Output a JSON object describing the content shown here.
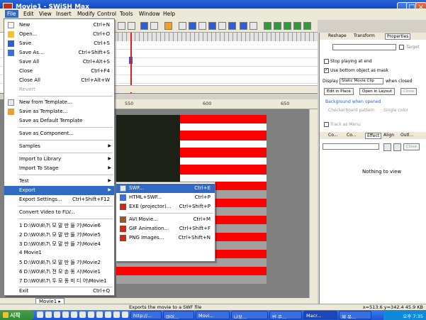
{
  "window": {
    "title": "Movie1 - SWiSH Max"
  },
  "menubar": {
    "items": [
      "File",
      "Edit",
      "View",
      "Insert",
      "Modify",
      "Control",
      "Tools",
      "Window",
      "Help"
    ]
  },
  "file_menu": {
    "items": [
      {
        "label": "New",
        "shortcut": "Ctrl+N",
        "icon": "new-doc-icon"
      },
      {
        "label": "Open...",
        "shortcut": "Ctrl+O",
        "icon": "open-folder-icon"
      },
      {
        "label": "Save",
        "shortcut": "Ctrl+S",
        "icon": "save-icon"
      },
      {
        "label": "Save As...",
        "shortcut": "Ctrl+Shift+S",
        "icon": "save-as-icon"
      },
      {
        "label": "Save All",
        "shortcut": "Ctrl+Alt+S",
        "icon": ""
      },
      {
        "label": "Close",
        "shortcut": "Ctrl+F4",
        "icon": ""
      },
      {
        "label": "Close All",
        "shortcut": "Ctrl+Alt+W",
        "icon": ""
      },
      {
        "label": "Revert",
        "shortcut": "",
        "icon": "",
        "disabled": true
      },
      {
        "label": "New from Template...",
        "shortcut": "",
        "icon": "template-icon"
      },
      {
        "label": "Save as Template...",
        "shortcut": "",
        "icon": "save-template-icon"
      },
      {
        "label": "Save as Default Template",
        "shortcut": "",
        "icon": ""
      },
      {
        "label": "Save as Component...",
        "shortcut": "",
        "icon": ""
      },
      {
        "label": "Samples",
        "shortcut": "",
        "icon": "",
        "submenu": true
      },
      {
        "label": "Import to Library",
        "shortcut": "",
        "icon": "",
        "submenu": true
      },
      {
        "label": "Import To Stage",
        "shortcut": "",
        "icon": "",
        "submenu": true
      },
      {
        "label": "Test",
        "shortcut": "",
        "icon": "",
        "submenu": true
      },
      {
        "label": "Export",
        "shortcut": "",
        "icon": "",
        "submenu": true,
        "highlight": true
      },
      {
        "label": "Export Settings...",
        "shortcut": "Ctrl+Shift+F12",
        "icon": ""
      },
      {
        "label": "Convert Video to FLV...",
        "shortcut": "",
        "icon": ""
      },
      {
        "label": "1 D:\\W0\\8\\7\\ 모 말 만 들 기\\Movie6",
        "shortcut": "",
        "icon": ""
      },
      {
        "label": "2 D:\\W0\\8\\7\\ 모 말 만 들 기\\Movie5",
        "shortcut": "",
        "icon": ""
      },
      {
        "label": "3 D:\\W0\\8\\7\\ 모 말 만 들 기\\Movie4",
        "shortcut": "",
        "icon": ""
      },
      {
        "label": "4 Movie1",
        "shortcut": "",
        "icon": ""
      },
      {
        "label": "5 D:\\W0\\8\\7\\ 모 말 만 들 기\\Movie2",
        "shortcut": "",
        "icon": ""
      },
      {
        "label": "6 D:\\W0\\8\\7\\ 전 모 손 동 시\\Movie1",
        "shortcut": "",
        "icon": ""
      },
      {
        "label": "7 D:\\W0\\8\\7\\ 두 모 동 미 디 어\\Movie1",
        "shortcut": "",
        "icon": ""
      },
      {
        "label": "Exit",
        "shortcut": "Ctrl+Q",
        "icon": ""
      }
    ]
  },
  "export_submenu": {
    "items": [
      {
        "label": "SWF...",
        "shortcut": "Ctrl+E",
        "icon": "swf-icon",
        "highlight": true
      },
      {
        "label": "HTML+SWF...",
        "shortcut": "Ctrl+P",
        "icon": "html-icon"
      },
      {
        "label": "EXE (projector)...",
        "shortcut": "Ctrl+Shift+P",
        "icon": "exe-icon"
      },
      {
        "label": "AVI Movie...",
        "shortcut": "Ctrl+M",
        "icon": "avi-icon"
      },
      {
        "label": "GIF Animation...",
        "shortcut": "Ctrl+Shift+F",
        "icon": "gif-icon"
      },
      {
        "label": "PNG Images...",
        "shortcut": "Ctrl+Shift+N",
        "icon": "png-icon"
      }
    ]
  },
  "stage": {
    "ruler_ticks": [
      "550",
      "600",
      "650"
    ]
  },
  "tabs": {
    "movie_tab": "Movie1 ▸"
  },
  "properties": {
    "tabs": [
      "Reshape",
      "Transform",
      "Properties"
    ],
    "target_label": "Target",
    "stop_playing": "Stop playing at end",
    "bottom_mask": "Use bottom object as mask",
    "display_label": "Display",
    "display_value": "Static Movie Clip",
    "when_closed": "when closed",
    "btn_edit": "Edit in Place",
    "btn_open": "Open in Layout",
    "btn_close": "Close",
    "background_label": "Background when opened",
    "checkerboard": "Checkerboard pattern",
    "single_color": "Single color",
    "track_as_menu": "Track as Menu"
  },
  "lower_panel": {
    "tabs": [
      "Co...",
      "Co...",
      "Effect",
      "Align",
      "Outl..."
    ],
    "empty_text": "Nothing to view"
  },
  "status": {
    "message": "Exports the movie to a SWF file",
    "coords": "x=513.6 y=342.4 45.9 KB"
  },
  "taskbar": {
    "start_label": "시작",
    "tasks": [
      "http://...",
      "마이...",
      "Movi...",
      "나모...",
      "빈 문...",
      "Macr...",
      "제 목..."
    ],
    "clock": "오후 7:35"
  },
  "colors": {
    "accent": "#316ac5",
    "stage_red": "#ff0000",
    "stage_dark": "#1b2117"
  }
}
